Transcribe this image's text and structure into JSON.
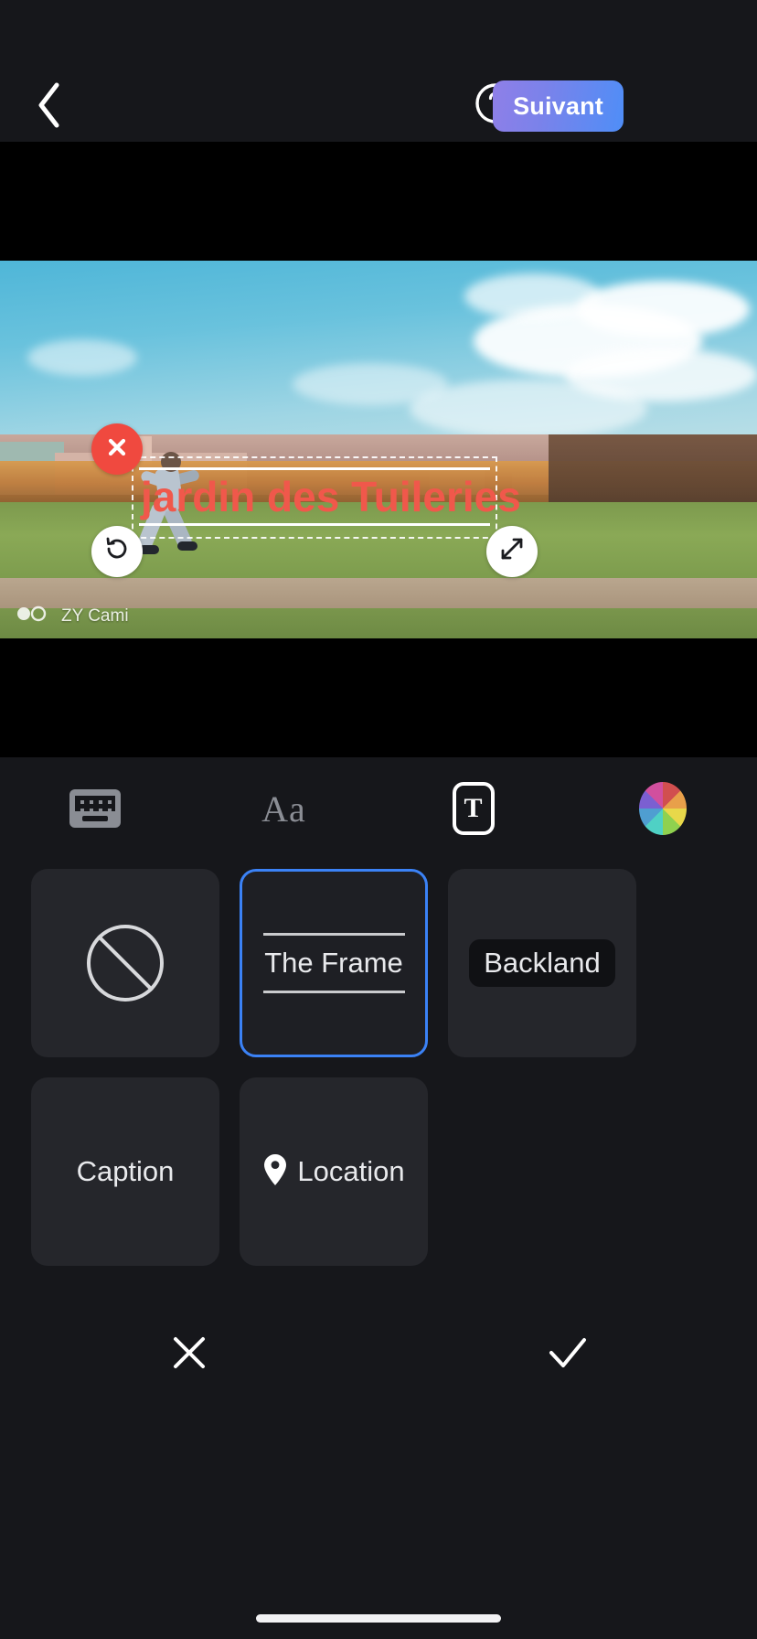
{
  "app": {
    "theme_background": "#16171b",
    "accent_blue": "#3b82f6",
    "overlay_text_color": "#f0584b"
  },
  "topbar": {
    "back_icon": "chevron-left-icon",
    "help_icon": "question-circle-icon",
    "next_label": "Suivant",
    "next_gradient_from": "#8f7fe8",
    "next_gradient_to": "#4f8ef7"
  },
  "canvas": {
    "overlay": {
      "text": "jardin des Tuileries",
      "style": "The Frame",
      "color": "#f0584b",
      "delete_icon": "close-circle-icon",
      "rotate_icon": "rotate-ccw-icon",
      "resize_icon": "resize-diagonal-icon"
    },
    "watermark": {
      "label": "ZY Cami"
    }
  },
  "toolbar": {
    "items": [
      {
        "name": "keyboard",
        "icon": "keyboard-icon",
        "label": "",
        "active": false
      },
      {
        "name": "font",
        "icon": "font-icon",
        "label": "Aa",
        "active": false
      },
      {
        "name": "text-style",
        "icon": "text-box-icon",
        "label": "T",
        "active": true
      },
      {
        "name": "color",
        "icon": "color-wheel-icon",
        "label": "",
        "active": false
      }
    ]
  },
  "styles": {
    "row1": [
      {
        "id": "none",
        "label": "",
        "icon": "no-style-icon",
        "selected": false
      },
      {
        "id": "the-frame",
        "label": "The Frame",
        "icon": "",
        "selected": true
      },
      {
        "id": "backland",
        "label": "Backland",
        "icon": "",
        "selected": false
      }
    ],
    "row2": [
      {
        "id": "caption",
        "label": "Caption",
        "icon": "",
        "selected": false
      },
      {
        "id": "location",
        "label": "Location",
        "icon": "location-pin-icon",
        "selected": false
      }
    ]
  },
  "confirm": {
    "cancel_icon": "close-icon",
    "accept_icon": "check-icon"
  }
}
